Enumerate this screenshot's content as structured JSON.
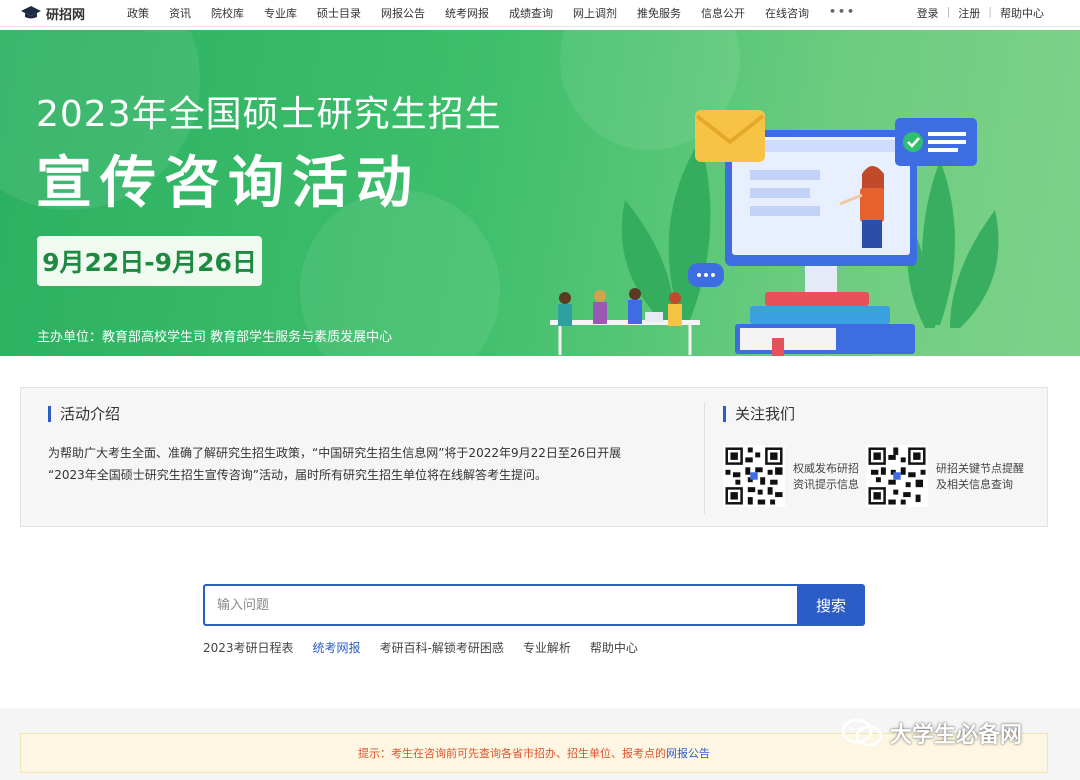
{
  "nav": {
    "logo": "研招网",
    "links": [
      "政策",
      "资讯",
      "院校库",
      "专业库",
      "硕士目录",
      "网报公告",
      "统考网报",
      "成绩查询",
      "网上调剂",
      "推免服务",
      "信息公开",
      "在线咨询"
    ],
    "more": "•••",
    "login": "登录",
    "register": "注册",
    "help": "帮助中心"
  },
  "banner": {
    "title": "2023年全国硕士研究生招生",
    "subtitle": "宣传咨询活动",
    "date": "9月22日-9月26日",
    "host": "主办单位：教育部高校学生司  教育部学生服务与素质发展中心"
  },
  "intro": {
    "title": "活动介绍",
    "line1": "为帮助广大考生全面、准确了解研究生招生政策，“中国研究生招生信息网”将于2022年9月22日至26日开展",
    "line2": "“2023年全国硕士研究生招生宣传咨询”活动，届时所有研究生招生单位将在线解答考生提问。"
  },
  "follow": {
    "title": "关注我们",
    "qr1_line1": "权威发布研招",
    "qr1_line2": "资讯提示信息",
    "qr2_line1": "研招关键节点提醒",
    "qr2_line2": "及相关信息查询"
  },
  "search": {
    "placeholder": "输入问题",
    "button": "搜索",
    "quicklinks": [
      "2023考研日程表",
      "统考网报",
      "考研百科-解锁考研困惑",
      "专业解析",
      "帮助中心"
    ]
  },
  "notice": {
    "text": "提示：考生在咨询前可先查询各省市招办、招生单位、报考点的",
    "link": "网报公告"
  },
  "watermark": "大学生必备网",
  "colors": {
    "primary_blue": "#2c5cc5",
    "banner_green": "#3fbf6c",
    "notice_text": "#e0532a"
  }
}
